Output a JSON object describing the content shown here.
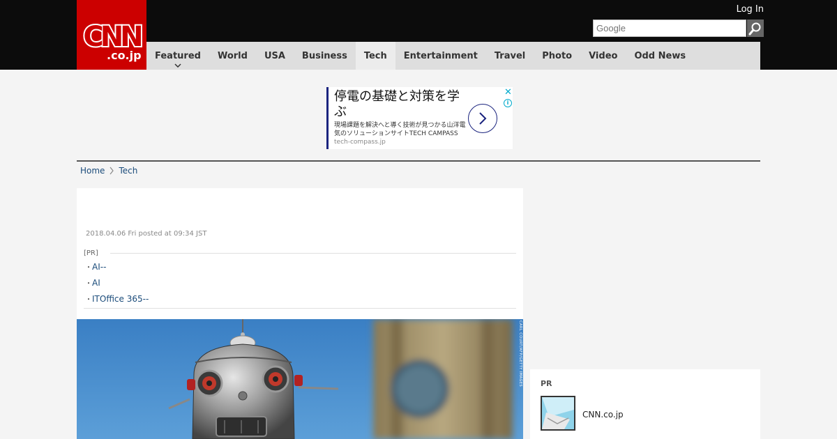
{
  "header": {
    "logo_text": "CNN",
    "logo_sub": ".co.jp",
    "login_label": "Log In",
    "search_placeholder": "Google",
    "colors": {
      "brand": "#cc0000",
      "bar": "#0c0c0c",
      "nav_bg": "#dedede"
    }
  },
  "nav": {
    "items": [
      {
        "label": "Featured"
      },
      {
        "label": "World"
      },
      {
        "label": "USA"
      },
      {
        "label": "Business"
      },
      {
        "label": "Tech"
      },
      {
        "label": "Entertainment"
      },
      {
        "label": "Travel"
      },
      {
        "label": "Photo"
      },
      {
        "label": "Video"
      },
      {
        "label": "Odd News"
      }
    ],
    "active": "Tech"
  },
  "ad": {
    "headline": "停電の基礎と対策を学ぶ",
    "body": "現場課題を解決へと導く技術が見つかる山洋電気のソリューションサイトTECH CAMPASS",
    "url": "tech-compass.jp"
  },
  "breadcrumb": {
    "home": "Home",
    "current": "Tech"
  },
  "article": {
    "dateline": "2018.04.06 Fri posted at 09:34 JST",
    "pr_label": "[PR]",
    "pr_links": [
      {
        "text": "AI--"
      },
      {
        "text": "AI"
      },
      {
        "text": "ITOffice 365--"
      }
    ],
    "image_credit": "CARL COURT/AFP/GETTY IMAGES"
  },
  "sidebar": {
    "pr_label": "PR",
    "pr_item_title": "CNN.co.jp"
  }
}
